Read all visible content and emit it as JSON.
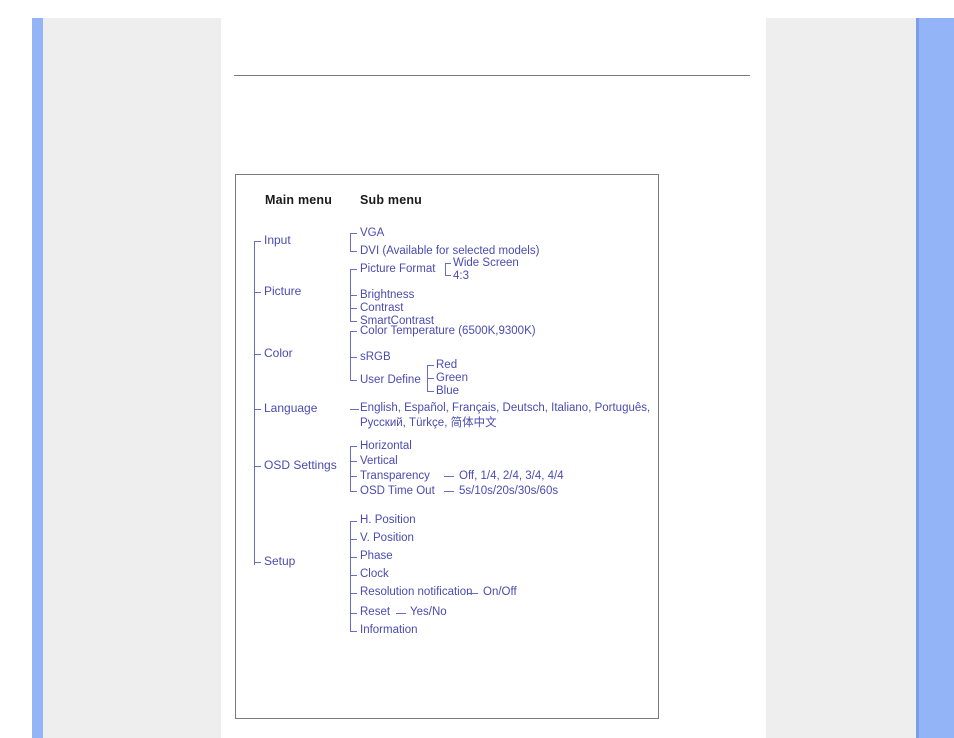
{
  "page": {
    "title": "OSD Menu Tree",
    "accent_blue": "#93b4f7",
    "panel_gray": "#eeeeee",
    "tree_text_color": "#4a4bb0",
    "heading_color": "#1a1a1a",
    "border_color": "#7a7a7a"
  },
  "headings": {
    "main_menu": "Main menu",
    "sub_menu": "Sub menu"
  },
  "menu": {
    "input": {
      "label": "Input",
      "items": [
        "VGA",
        "DVI (Available for selected models)"
      ]
    },
    "picture": {
      "label": "Picture",
      "items": [
        "Picture Format",
        "Brightness",
        "Contrast",
        "SmartContrast"
      ],
      "picture_format_options": [
        "Wide Screen",
        "4:3"
      ]
    },
    "color": {
      "label": "Color",
      "items": [
        "Color Temperature (6500K,9300K)",
        "sRGB",
        "User Define"
      ],
      "user_define_options": [
        "Red",
        "Green",
        "Blue"
      ]
    },
    "language": {
      "label": "Language",
      "line1": "English, Español, Français, Deutsch, Italiano, Português,",
      "line2": "Русский, Türkçe, 简体中文"
    },
    "osd_settings": {
      "label": "OSD Settings",
      "items": [
        "Horizontal",
        "Vertical",
        "Transparency",
        "OSD Time Out"
      ],
      "transparency_values": "Off, 1/4, 2/4, 3/4, 4/4",
      "osd_time_out_values": "5s/10s/20s/30s/60s"
    },
    "setup": {
      "label": "Setup",
      "items": [
        "H. Position",
        "V. Position",
        "Phase",
        "Clock",
        "Resolution notification",
        "Reset",
        "Information"
      ],
      "resolution_notification_values": "On/Off",
      "reset_values": "Yes/No"
    }
  }
}
